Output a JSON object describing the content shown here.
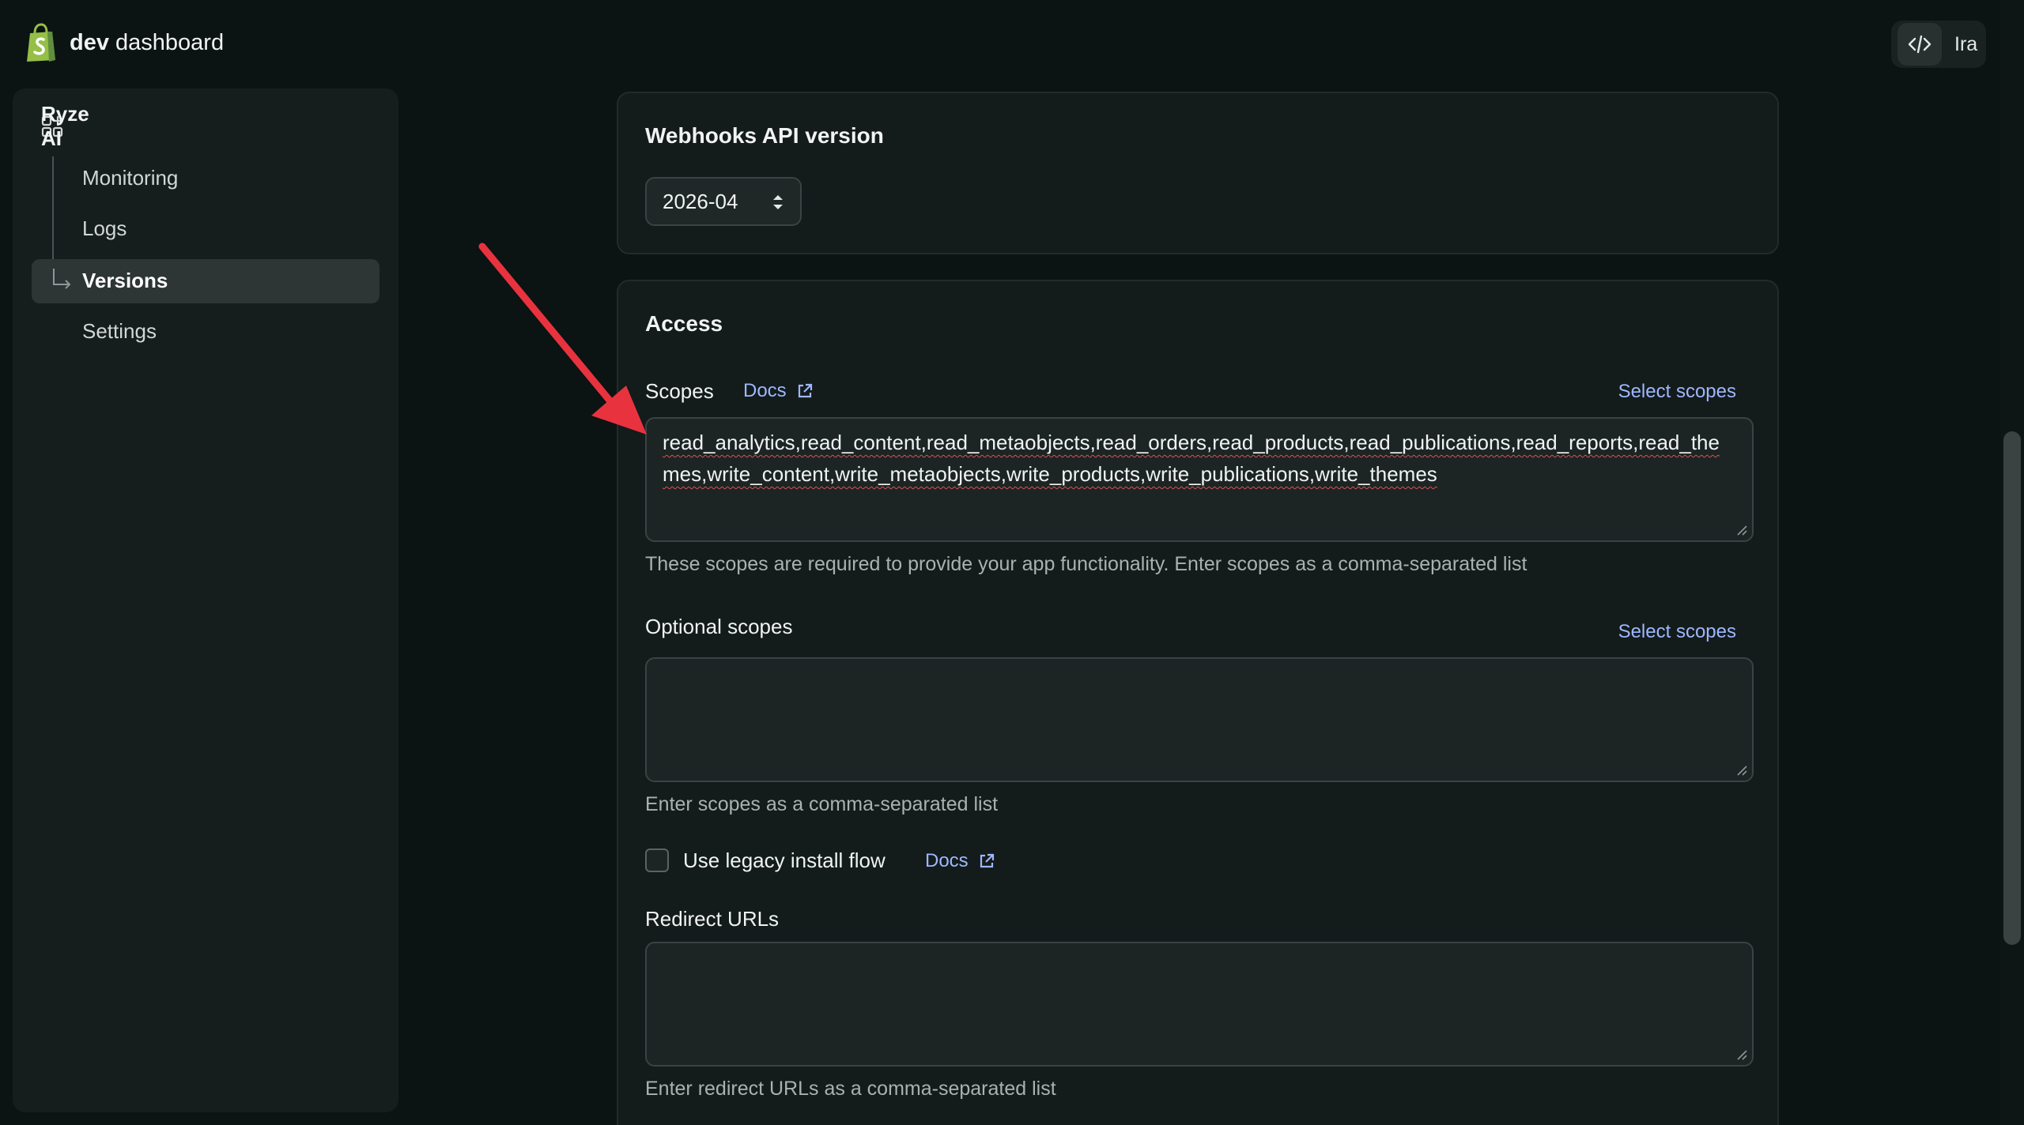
{
  "header": {
    "brand_bold": "dev",
    "brand_rest": " dashboard",
    "user_name": "Ira"
  },
  "sidebar": {
    "app_name": "Ryze AI",
    "items": [
      {
        "label": "Monitoring"
      },
      {
        "label": "Logs"
      },
      {
        "label": "Versions"
      },
      {
        "label": "Settings"
      }
    ],
    "active_item": "Versions"
  },
  "webhooks": {
    "title": "Webhooks API version",
    "selected_version": "2026-04"
  },
  "access": {
    "title": "Access",
    "scopes_label": "Scopes",
    "docs_label": "Docs",
    "select_scopes_label": "Select scopes",
    "scopes_value": "read_analytics,read_content,read_metaobjects,read_orders,read_products,read_publications,read_reports,read_themes,write_content,write_metaobjects,write_products,write_publications,write_themes",
    "scopes_help": "These scopes are required to provide your app functionality. Enter scopes as a comma-separated list",
    "optional_label": "Optional scopes",
    "optional_select_label": "Select scopes",
    "optional_value": "",
    "optional_help": "Enter scopes as a comma-separated list",
    "legacy_label": "Use legacy install flow",
    "legacy_docs_label": "Docs",
    "legacy_checked": false,
    "redirect_label": "Redirect URLs",
    "redirect_value": "",
    "redirect_help": "Enter redirect URLs as a comma-separated list"
  },
  "colors": {
    "background": "#0c1313",
    "card": "#141b1b",
    "link": "#9db8ff",
    "brand_green": "#95bf47",
    "annotation_red": "#e8333f"
  }
}
